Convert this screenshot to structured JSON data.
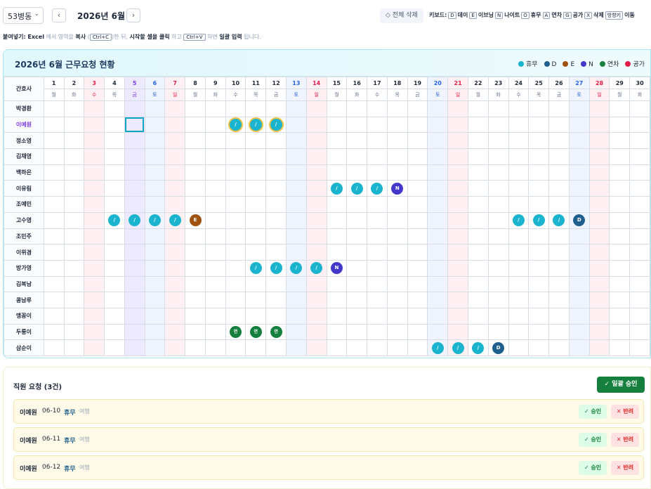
{
  "toolbar": {
    "ward": "53병동",
    "month": "2026년 6월",
    "delete_all": "전체 삭제",
    "shortcuts_label": "키보드:",
    "shortcuts": [
      {
        "key": "D",
        "label": "데이"
      },
      {
        "key": "E",
        "label": "이브닝"
      },
      {
        "key": "N",
        "label": "나이트"
      },
      {
        "key": "O",
        "label": "휴무"
      },
      {
        "key": "A",
        "label": "연차"
      },
      {
        "key": "G",
        "label": "공가"
      },
      {
        "key": "X",
        "label": "삭제"
      },
      {
        "key": "방향키",
        "label": "이동"
      }
    ]
  },
  "hint": {
    "p1": "붙여넣기: Excel",
    "p2": " 에서 영역을 ",
    "p3": "복사",
    "p4": " (",
    "k1": "Ctrl+C",
    "p5": ")한 뒤, ",
    "p6": "시작할 셀을 클릭",
    "p7": " 하고 ",
    "k2": "Ctrl+V",
    "p8": " 하면 ",
    "p9": "일괄 입력",
    "p10": " 됩니다."
  },
  "grid": {
    "title": "2026년 6월 근무요청 현황",
    "nurse_header": "간호사",
    "legend": [
      {
        "label": "휴무",
        "color": "#1ab4cf"
      },
      {
        "label": "D",
        "color": "#1e5f8e"
      },
      {
        "label": "E",
        "color": "#a0520f"
      },
      {
        "label": "N",
        "color": "#4338ca"
      },
      {
        "label": "연차",
        "color": "#15803d"
      },
      {
        "label": "공가",
        "color": "#e11d48"
      }
    ],
    "days": [
      {
        "d": "1",
        "w": "월"
      },
      {
        "d": "2",
        "w": "화"
      },
      {
        "d": "3",
        "w": "수"
      },
      {
        "d": "4",
        "w": "목"
      },
      {
        "d": "5",
        "w": "금"
      },
      {
        "d": "6",
        "w": "토"
      },
      {
        "d": "7",
        "w": "일"
      },
      {
        "d": "8",
        "w": "월"
      },
      {
        "d": "9",
        "w": "화"
      },
      {
        "d": "10",
        "w": "수"
      },
      {
        "d": "11",
        "w": "목"
      },
      {
        "d": "12",
        "w": "금"
      },
      {
        "d": "13",
        "w": "토"
      },
      {
        "d": "14",
        "w": "일"
      },
      {
        "d": "15",
        "w": "월"
      },
      {
        "d": "16",
        "w": "화"
      },
      {
        "d": "17",
        "w": "수"
      },
      {
        "d": "18",
        "w": "목"
      },
      {
        "d": "19",
        "w": "금"
      },
      {
        "d": "20",
        "w": "토"
      },
      {
        "d": "21",
        "w": "일"
      },
      {
        "d": "22",
        "w": "월"
      },
      {
        "d": "23",
        "w": "화"
      },
      {
        "d": "24",
        "w": "수"
      },
      {
        "d": "25",
        "w": "목"
      },
      {
        "d": "26",
        "w": "금"
      },
      {
        "d": "27",
        "w": "토"
      },
      {
        "d": "28",
        "w": "일"
      },
      {
        "d": "29",
        "w": "월"
      },
      {
        "d": "30",
        "w": "화"
      }
    ],
    "holidays": [
      3
    ],
    "today": 5,
    "selected": {
      "row": 1,
      "day": 5
    },
    "nurses": [
      {
        "name": "박경환",
        "shifts": {}
      },
      {
        "name": "이예원",
        "active": true,
        "shifts": {
          "10": "R*",
          "11": "R*",
          "12": "R*"
        }
      },
      {
        "name": "정소영",
        "shifts": {}
      },
      {
        "name": "김채영",
        "shifts": {}
      },
      {
        "name": "백하은",
        "shifts": {}
      },
      {
        "name": "이유림",
        "shifts": {
          "15": "R",
          "16": "R",
          "17": "R",
          "18": "N"
        }
      },
      {
        "name": "조예민",
        "shifts": {}
      },
      {
        "name": "고수영",
        "shifts": {
          "4": "R",
          "5": "R",
          "6": "R",
          "7": "R",
          "8": "E",
          "24": "R",
          "25": "R",
          "26": "R",
          "27": "D"
        }
      },
      {
        "name": "조민주",
        "shifts": {}
      },
      {
        "name": "이위경",
        "shifts": {}
      },
      {
        "name": "방가영",
        "shifts": {
          "11": "R",
          "12": "R",
          "13": "R",
          "14": "R",
          "15": "N"
        }
      },
      {
        "name": "김복남",
        "shifts": {}
      },
      {
        "name": "콩남루",
        "shifts": {}
      },
      {
        "name": "맹꽁이",
        "shifts": {}
      },
      {
        "name": "두룽이",
        "shifts": {
          "10": "A",
          "11": "A",
          "12": "A"
        }
      },
      {
        "name": "삼순이",
        "shifts": {
          "20": "R",
          "21": "R",
          "22": "R",
          "23": "D"
        }
      }
    ],
    "glyphs": {
      "R": "/",
      "D": "D",
      "E": "E",
      "N": "N",
      "A": "연",
      "G": "공"
    }
  },
  "requests": {
    "title": "직원 요청 (3건)",
    "bulk_approve": "일괄 승인",
    "approve": "승인",
    "reject": "반려",
    "items": [
      {
        "name": "이예원",
        "date": "06-10",
        "type": "휴무",
        "reason": "여행"
      },
      {
        "name": "이예원",
        "date": "06-11",
        "type": "휴무",
        "reason": "여행"
      },
      {
        "name": "이예원",
        "date": "06-12",
        "type": "휴무",
        "reason": "여행"
      }
    ]
  }
}
